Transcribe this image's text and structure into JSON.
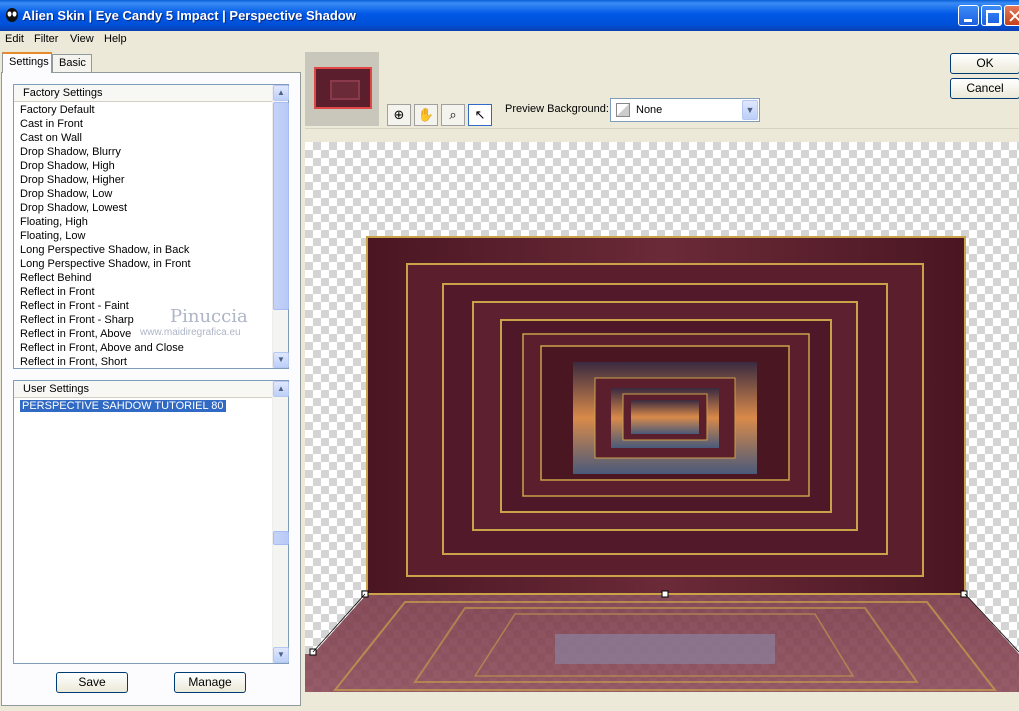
{
  "window": {
    "title": "Alien Skin  |  Eye Candy 5 Impact  |  Perspective Shadow"
  },
  "menu": [
    "Edit",
    "Filter",
    "View",
    "Help"
  ],
  "tabs": [
    "Settings",
    "Basic"
  ],
  "factory": {
    "header": "Factory Settings",
    "items": [
      "Factory Default",
      "Cast in Front",
      "Cast on Wall",
      "Drop Shadow, Blurry",
      "Drop Shadow, High",
      "Drop Shadow, Higher",
      "Drop Shadow, Low",
      "Drop Shadow, Lowest",
      "Floating, High",
      "Floating, Low",
      "Long Perspective Shadow, in Back",
      "Long Perspective Shadow, in Front",
      "Reflect Behind",
      "Reflect in Front",
      "Reflect in Front - Faint",
      "Reflect in Front - Sharp",
      "Reflect in Front, Above",
      "Reflect in Front, Above and Close",
      "Reflect in Front, Short"
    ]
  },
  "user": {
    "header": "User Settings",
    "items": [
      "PERSPECTIVE SAHDOW TUTORIEL 80"
    ],
    "selected_index": 0
  },
  "buttons": {
    "save": "Save",
    "manage": "Manage",
    "ok": "OK",
    "cancel": "Cancel"
  },
  "toolbar": {
    "tools": [
      "zoom-fit-icon",
      "hand-icon",
      "magnifier-icon",
      "arrow-pointer-icon"
    ],
    "active_tool": "arrow-pointer-icon"
  },
  "preview_background": {
    "label": "Preview Background:",
    "value": "None"
  },
  "watermark": {
    "line1": "Pinuccia",
    "line2": "www.maidiregrafica.eu"
  },
  "colors": {
    "titlebar": "#0058e6",
    "frame": "#5a1e2c",
    "gold": "#c9a24a",
    "selection": "#316ac5"
  }
}
